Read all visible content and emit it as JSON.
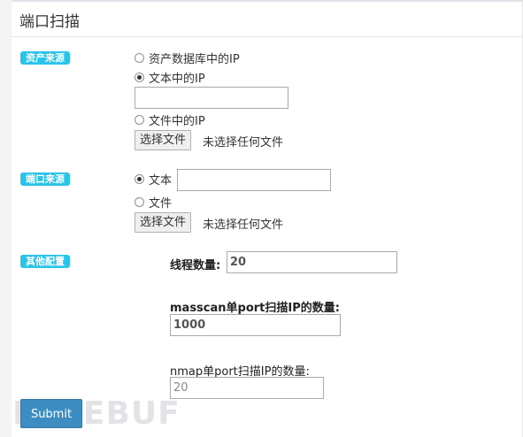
{
  "title": "端口扫描",
  "asset_source": {
    "badge": "资产来源",
    "options": [
      "资产数据库中的IP",
      "文本中的IP",
      "文件中的IP"
    ],
    "selected_index": 1,
    "text_value": "",
    "file_button": "选择文件",
    "file_status": "未选择任何文件"
  },
  "port_source": {
    "badge": "端口来源",
    "options": [
      "文本",
      "文件"
    ],
    "selected_index": 0,
    "text_value": "",
    "file_button": "选择文件",
    "file_status": "未选择任何文件"
  },
  "other_config": {
    "badge": "其他配置",
    "threads_label": "线程数量:",
    "threads_value": "20",
    "masscan_label": "masscan单port扫描IP的数量:",
    "masscan_value": "1000",
    "nmap_label": "nmap单port扫描IP的数量:",
    "nmap_value": "20"
  },
  "submit_label": "Submit",
  "watermark": "FREEBUF"
}
